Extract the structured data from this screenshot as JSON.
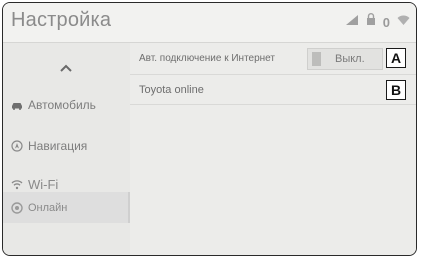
{
  "header": {
    "title": "Настройка"
  },
  "status_bar": {
    "icons": [
      "signal-icon",
      "lock-icon",
      "bluetooth-icon",
      "wifi-icon"
    ],
    "value": "0"
  },
  "sidebar": {
    "up_icon": "chevron-up-icon",
    "items": [
      {
        "label": "Автомобиль",
        "icon": "car-icon",
        "selected": false
      },
      {
        "label": "Навигация",
        "icon": "navigation-icon",
        "selected": false
      },
      {
        "label": "Wi-Fi",
        "icon": "wifi-icon",
        "selected": false
      },
      {
        "label": "Онлайн",
        "icon": "online-icon",
        "selected": true
      }
    ]
  },
  "main": {
    "rows": [
      {
        "label": "Авт. подключение к Интернет",
        "toggle_label": "Выкл.",
        "callout": "A"
      },
      {
        "label": "Toyota online",
        "callout": "B"
      }
    ]
  },
  "colors": {
    "background": "#e9e9e7",
    "text": "#7d7d7d",
    "selected": "#dedede"
  }
}
